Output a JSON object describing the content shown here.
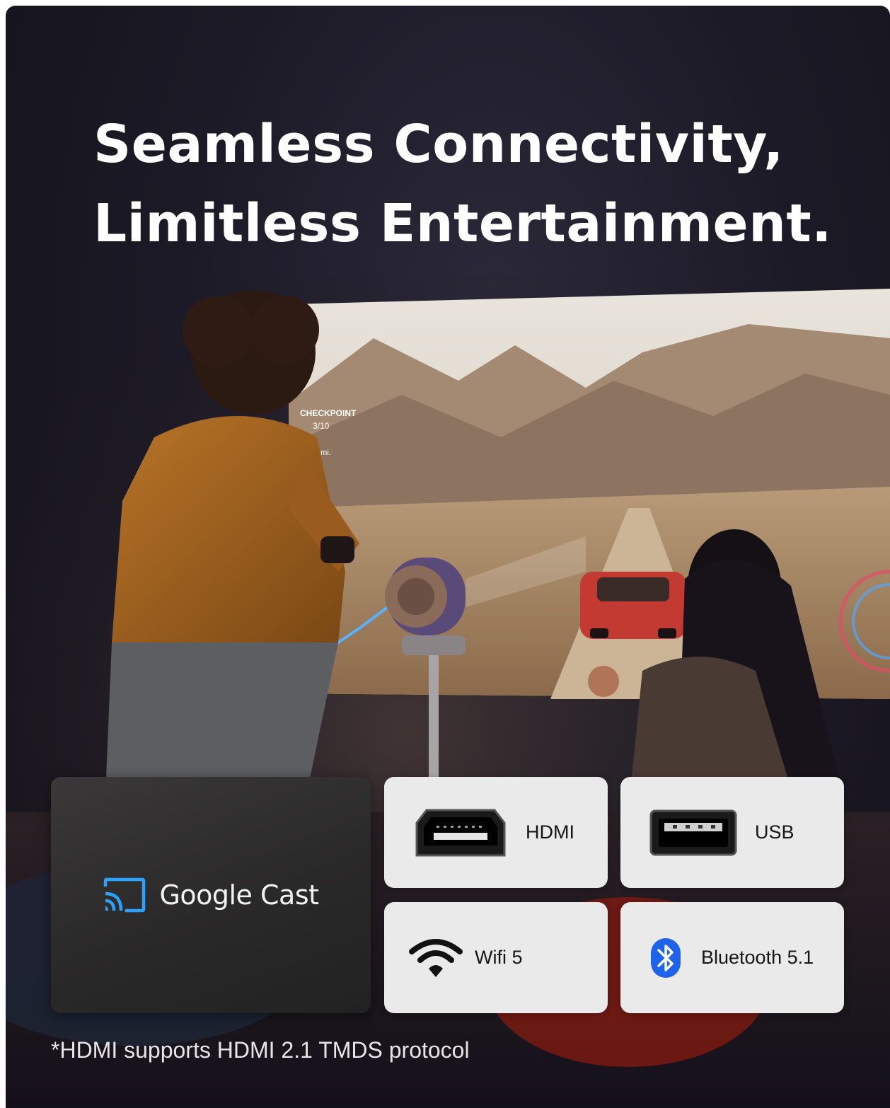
{
  "headline": {
    "line1": "Seamless Connectivity,",
    "line2": "Limitless Entertainment."
  },
  "screen": {
    "hud_checkpoint": "CHECKPOINT",
    "hud_progress": "3/10",
    "hud_distance": "2 mi."
  },
  "features": {
    "google_cast": {
      "label": "Google Cast",
      "icon": "cast-icon"
    },
    "hdmi": {
      "label": "HDMI",
      "icon": "hdmi-port-icon"
    },
    "usb": {
      "label": "USB",
      "icon": "usb-port-icon"
    },
    "wifi": {
      "label": "Wifi 5",
      "icon": "wifi-icon"
    },
    "bluetooth": {
      "label": "Bluetooth 5.1",
      "icon": "bluetooth-icon"
    }
  },
  "footnote": "*HDMI supports HDMI 2.1 TMDS protocol",
  "colors": {
    "background": "#1c1a26",
    "tile_light": "#ebeaea",
    "tile_dark": "#2a2929",
    "cast_blue": "#29a3ff",
    "bluetooth_blue": "#1e63e9"
  }
}
